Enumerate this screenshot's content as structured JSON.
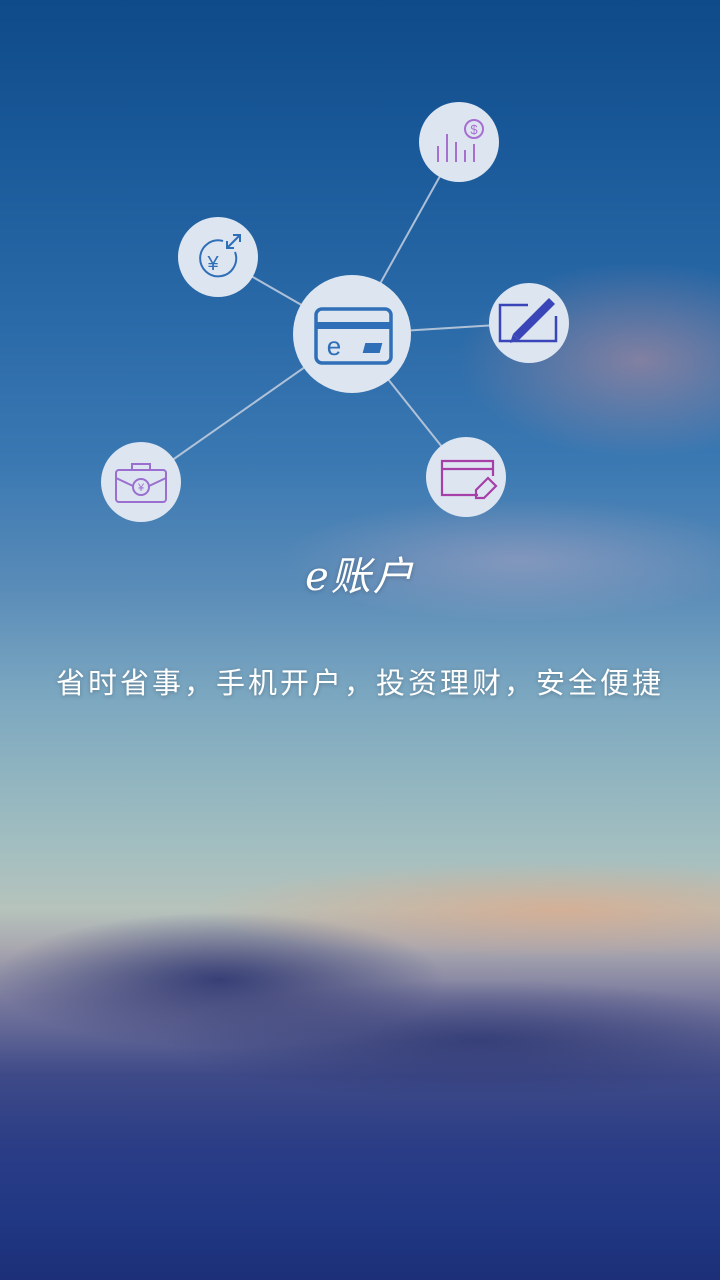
{
  "app": {
    "title": "e账户",
    "tagline": "省时省事，手机开户，投资理财，安全便捷"
  },
  "icons": {
    "center": "e-card-icon",
    "nodes": [
      "yuan-exchange-icon",
      "chart-dollar-icon",
      "pen-sign-icon",
      "card-tag-icon",
      "briefcase-yuan-icon"
    ]
  },
  "colors": {
    "node_fill": "#dde5f1",
    "line": "#c6d0e0",
    "icon_blue": "#2f6fb8",
    "icon_purple": "#8c47c8",
    "icon_magenta": "#a63fa8"
  }
}
